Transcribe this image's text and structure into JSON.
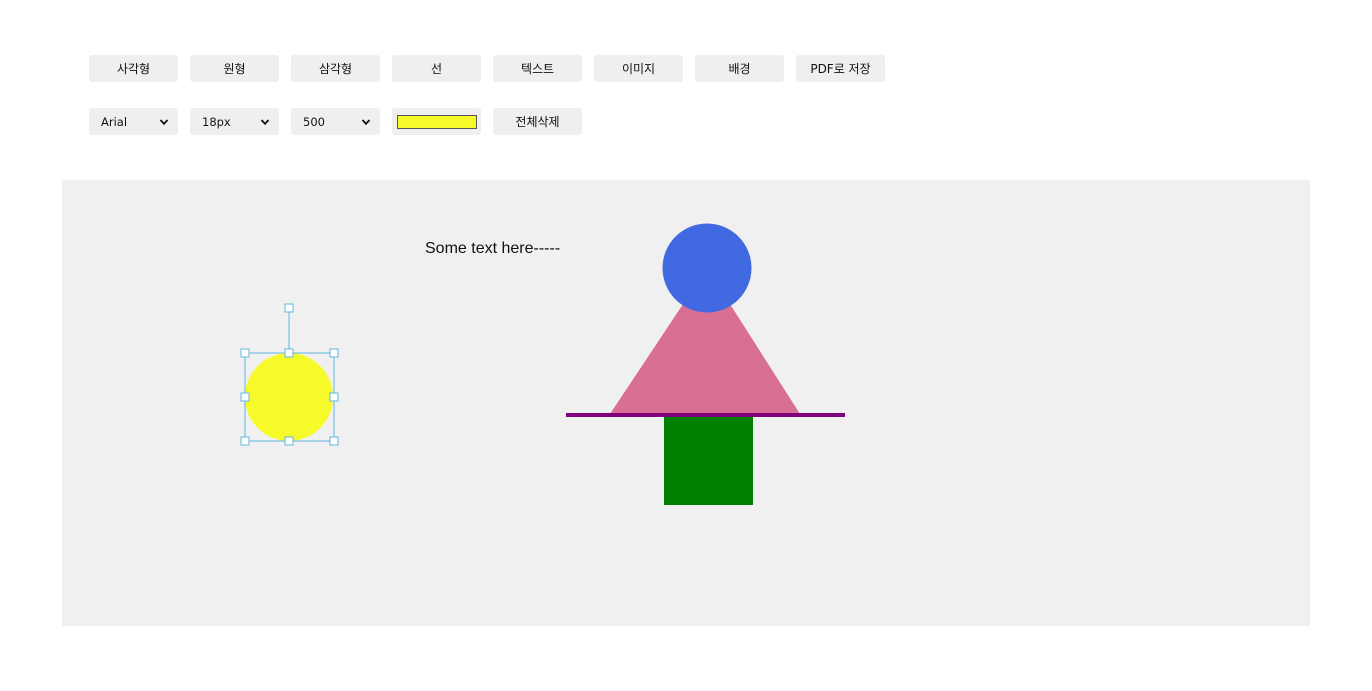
{
  "toolbar": {
    "buttons": [
      "사각형",
      "원형",
      "삼각형",
      "선",
      "텍스트",
      "이미지",
      "배경",
      "PDF로 저장"
    ],
    "font_family": "Arial",
    "font_size": "18px",
    "font_weight": "500",
    "color": "#f5fa28",
    "clear_all": "전체삭제"
  },
  "canvas": {
    "background": "#f0f0f0",
    "text_object": "Some text here-----",
    "shapes": {
      "selected_circle_color": "#f5fa28",
      "selection_handle_color": "#5fb7e5",
      "blue_circle_color": "#4169e1",
      "triangle_color": "#d87093",
      "line_color": "#800080",
      "square_color": "#008000"
    }
  }
}
